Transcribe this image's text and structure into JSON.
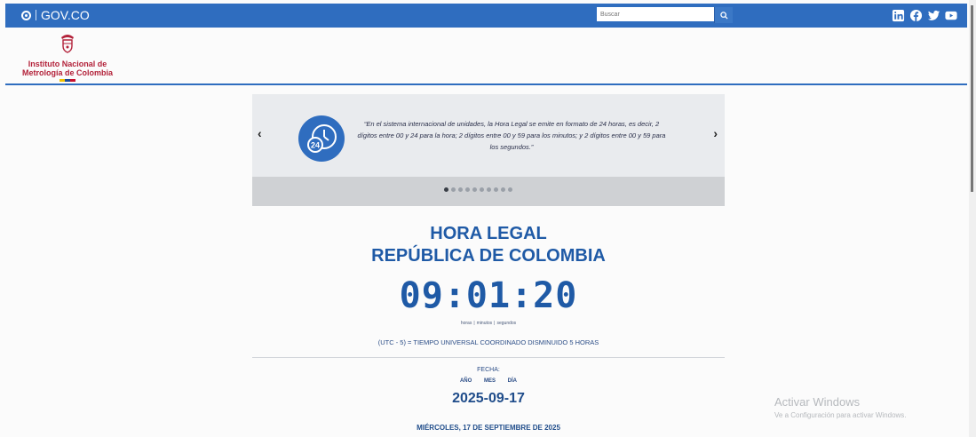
{
  "govbar": {
    "logo_text": "GOV.CO",
    "search_placeholder": "Buscar",
    "social": [
      "linkedin-icon",
      "facebook-icon",
      "twitter-icon",
      "youtube-icon"
    ]
  },
  "header": {
    "institute_line1": "Instituto Nacional de",
    "institute_line2": "Metrología de Colombia"
  },
  "carousel": {
    "quote": "“En el sistema internacional de unidades, la Hora Legal se emite en formato de 24 horas, es decir, 2 dígitos entre 00 y 24 para la hora; 2 dígitos entre 00 y 59 para los minutos; y 2 dígitos entre 00 y 59 para los segundos.”",
    "dot_count": 10,
    "active_dot": 0,
    "prev": "‹",
    "next": "›"
  },
  "clock": {
    "title_line1": "HORA LEGAL",
    "title_line2": "REPÚBLICA DE COLOMBIA",
    "time": "09:01:20",
    "unit_hours": "horas",
    "unit_minutes": "minutos",
    "unit_seconds": "segundos",
    "utc_note": "(UTC - 5) = TIEMPO UNIVERSAL COORDINADO DISMINUIDO 5 HORAS",
    "fecha_label": "FECHA:",
    "year_label": "AÑO",
    "month_label": "MES",
    "day_label": "DÍA",
    "date": "2025-09-17",
    "day_line": "MIÉRCOLES, 17 DE SEPTIEMBRE DE 2025"
  },
  "watermark": {
    "line1": "Activar Windows",
    "line2": "Ve a Configuración para activar Windows."
  },
  "colors": {
    "brand_blue": "#2f6dbf",
    "title_blue": "#1f5aa6",
    "institute_red": "#b3223a"
  }
}
